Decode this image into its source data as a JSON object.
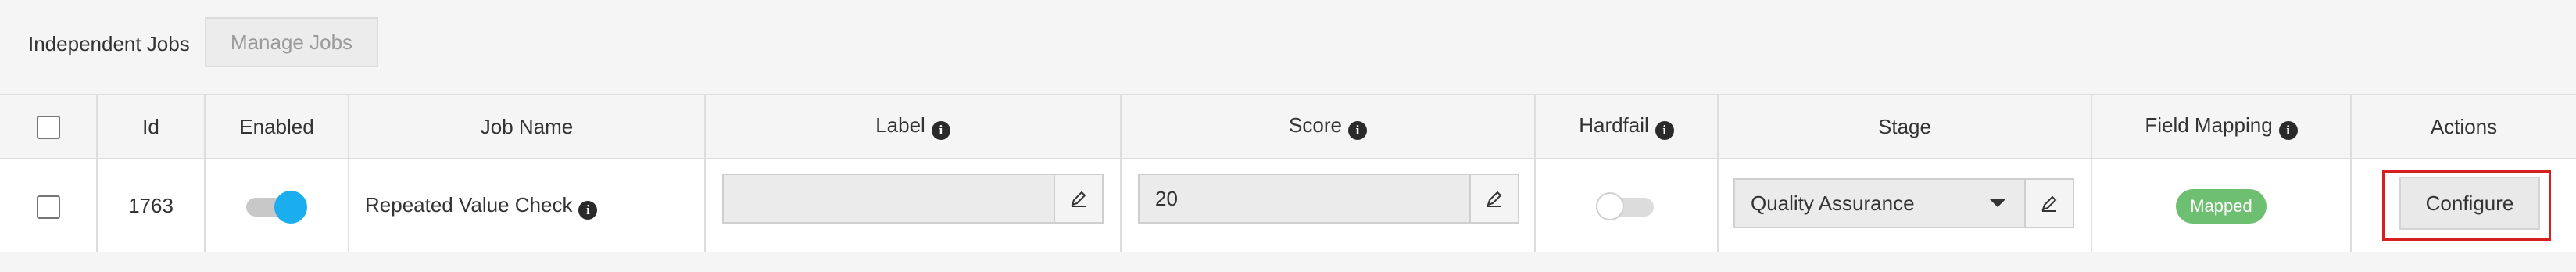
{
  "header": {
    "title": "Independent Jobs",
    "manage_jobs_label": "Manage Jobs"
  },
  "table": {
    "columns": [
      "",
      "Id",
      "Enabled",
      "Job Name",
      "Label",
      "Score",
      "Hardfail",
      "Stage",
      "Field Mapping",
      "Actions"
    ],
    "info_icon_columns": [
      "Label",
      "Score",
      "Hardfail",
      "Field Mapping"
    ],
    "rows": [
      {
        "id": "1763",
        "enabled": true,
        "job_name": "Repeated Value Check",
        "label_value": "",
        "score_value": "20",
        "hardfail": false,
        "stage": "Quality Assurance",
        "field_mapping": "Mapped",
        "action_label": "Configure"
      }
    ]
  },
  "icons": {
    "info": "info-icon",
    "edit": "pencil-edit-icon",
    "dropdown": "chevron-down-icon"
  },
  "colors": {
    "toggle_on": "#1aaeef",
    "mapped_badge": "#6fbf73",
    "highlight": "#d62020"
  }
}
